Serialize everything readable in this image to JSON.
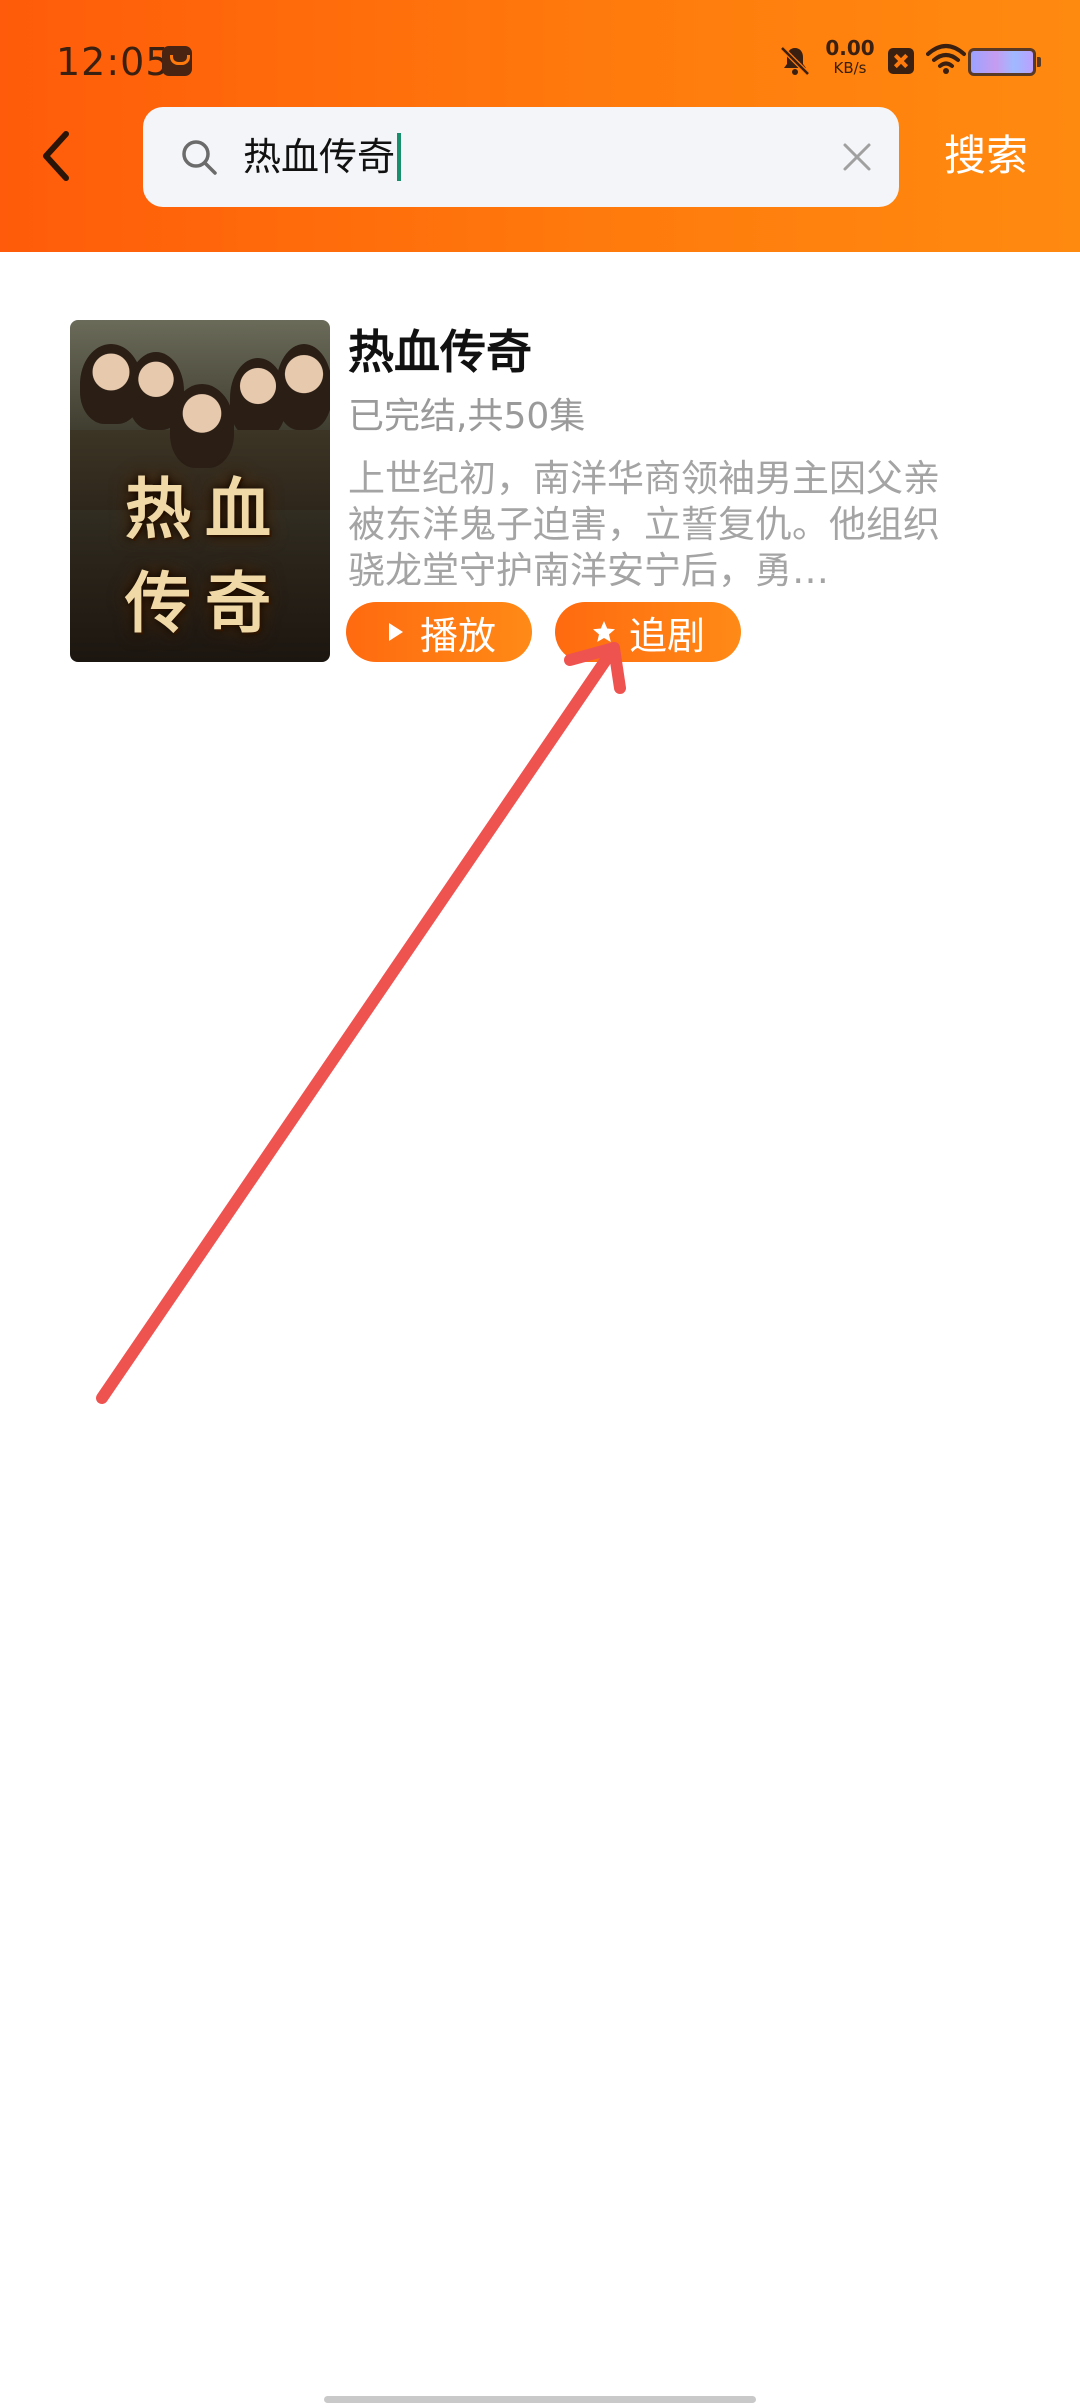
{
  "status_bar": {
    "time": "12:05",
    "net_speed_value": "0.00",
    "net_speed_unit": "KB/s",
    "icons": [
      "shopping-bag-icon",
      "bell-muted-icon",
      "close-box-icon",
      "wifi-icon",
      "battery-icon"
    ]
  },
  "header": {
    "back_icon": "chevron-left-icon",
    "search": {
      "value": "热血传奇",
      "icon": "search-icon",
      "clear_icon": "clear-icon"
    },
    "search_button": "搜索"
  },
  "result": {
    "poster_title_line1": "热血",
    "poster_title_line2": "传奇",
    "title": "热血传奇",
    "status": "已完结,共50集",
    "description": "上世纪初，南洋华商领袖男主因父亲被东洋鬼子迫害，立誓复仇。他组织骁龙堂守护南洋安宁后，勇…",
    "play_button": "播放",
    "follow_button": "追剧"
  },
  "colors": {
    "header_start": "#ff5b0a",
    "header_end": "#ff8a10",
    "button": "#ff7a12",
    "arrow": "#ef5350"
  }
}
